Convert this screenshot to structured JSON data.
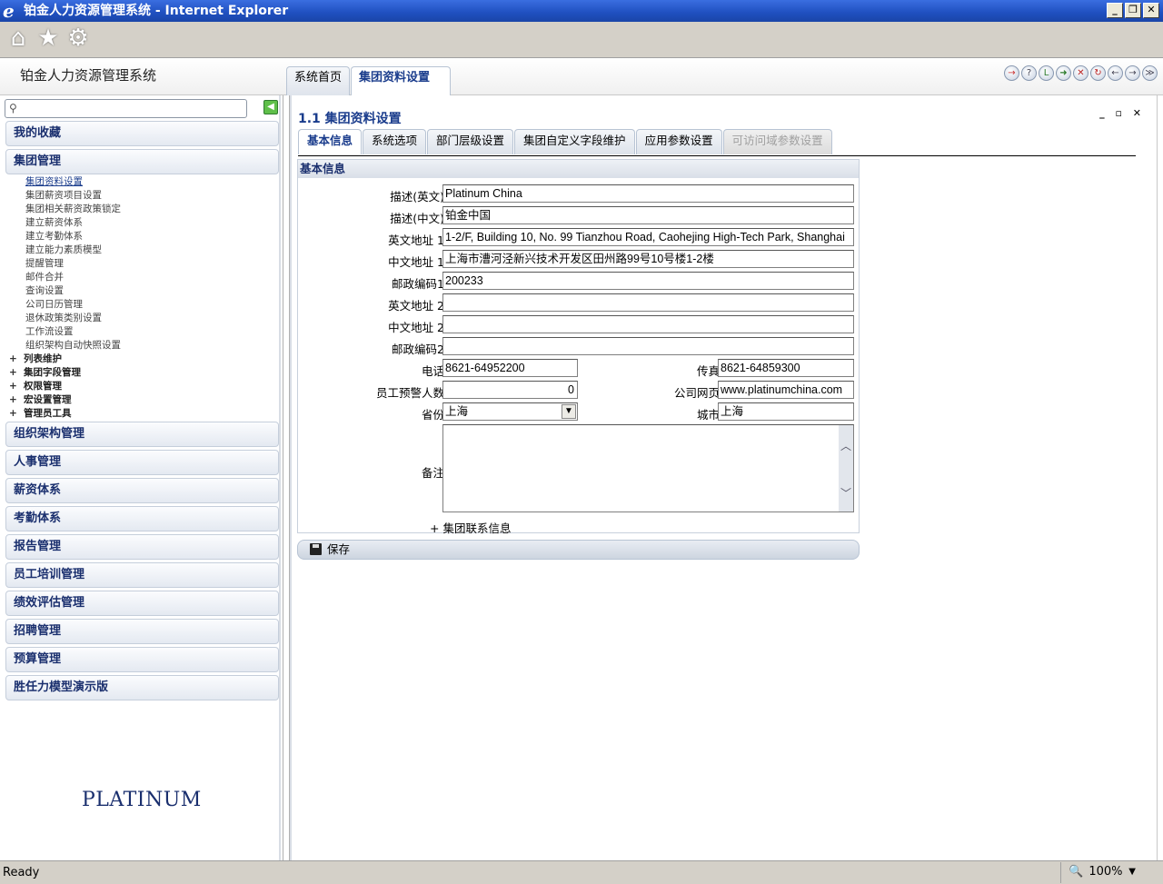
{
  "window": {
    "title": "铂金人力资源管理系统 - Internet Explorer",
    "controls": [
      "_",
      "❐",
      "✕"
    ]
  },
  "toolbar": {
    "icons": [
      "home-icon",
      "star-icon",
      "gear-icon"
    ]
  },
  "app": {
    "title": "铂金人力资源管理系统",
    "tabs": [
      {
        "label": "系统首页",
        "active": false
      },
      {
        "label": "集团资料设置",
        "active": true
      }
    ],
    "action_icons": [
      "logout-icon",
      "help-icon",
      "user-lock-icon",
      "user-go-icon",
      "close-icon",
      "refresh-icon",
      "back-icon",
      "forward-icon",
      "collapse-icon"
    ]
  },
  "sidebar": {
    "search_placeholder": "",
    "sections_top": [
      "我的收藏",
      "集团管理"
    ],
    "group_items": [
      {
        "label": "集团资料设置",
        "selected": true
      },
      {
        "label": "集团薪资项目设置",
        "selected": false
      },
      {
        "label": "集团相关薪资政策锁定",
        "selected": false
      },
      {
        "label": "建立薪资体系",
        "selected": false
      },
      {
        "label": "建立考勤体系",
        "selected": false
      },
      {
        "label": "建立能力素质模型",
        "selected": false
      },
      {
        "label": "提醒管理",
        "selected": false
      },
      {
        "label": "邮件合并",
        "selected": false
      },
      {
        "label": "查询设置",
        "selected": false
      },
      {
        "label": "公司日历管理",
        "selected": false
      },
      {
        "label": "退休政策类别设置",
        "selected": false
      },
      {
        "label": "工作流设置",
        "selected": false
      },
      {
        "label": "组织架构自动快照设置",
        "selected": false
      }
    ],
    "expandable_groups": [
      "列表维护",
      "集团字段管理",
      "权限管理",
      "宏设置管理",
      "管理员工具"
    ],
    "sections_bottom": [
      "组织架构管理",
      "人事管理",
      "薪资体系",
      "考勤体系",
      "报告管理",
      "员工培训管理",
      "绩效评估管理",
      "招聘管理",
      "预算管理",
      "胜任力模型演示版"
    ],
    "brand": "PLATINUM"
  },
  "main": {
    "page_title": "1.1 集团资料设置",
    "window_controls": "_ ▫ ✕",
    "tabs": [
      {
        "label": "基本信息",
        "state": "active"
      },
      {
        "label": "系统选项",
        "state": "normal"
      },
      {
        "label": "部门层级设置",
        "state": "normal"
      },
      {
        "label": "集团自定义字段维护",
        "state": "normal"
      },
      {
        "label": "应用参数设置",
        "state": "normal"
      },
      {
        "label": "可访问域参数设置",
        "state": "disabled"
      }
    ],
    "panel_title": "基本信息",
    "form": {
      "desc_en": {
        "label": "描述(英文)",
        "value": "Platinum China"
      },
      "desc_cn": {
        "label": "描述(中文)",
        "value": "铂金中国"
      },
      "addr_en1": {
        "label": "英文地址 1",
        "value": "1-2/F, Building 10, No. 99 Tianzhou Road, Caohejing High-Tech Park, Shanghai"
      },
      "addr_cn1": {
        "label": "中文地址 1",
        "value": "上海市漕河泾新兴技术开发区田州路99号10号楼1-2楼"
      },
      "zip1": {
        "label": "邮政编码1",
        "value": "200233"
      },
      "addr_en2": {
        "label": "英文地址 2",
        "value": ""
      },
      "addr_cn2": {
        "label": "中文地址 2",
        "value": ""
      },
      "zip2": {
        "label": "邮政编码2",
        "value": ""
      },
      "phone": {
        "label": "电话",
        "value": "8621-64952200"
      },
      "fax": {
        "label": "传真",
        "value": "8621-64859300"
      },
      "warn_count": {
        "label": "员工预警人数",
        "value": "0"
      },
      "website": {
        "label": "公司网页",
        "value": "www.platinumchina.com"
      },
      "province": {
        "label": "省份",
        "value": "上海"
      },
      "city": {
        "label": "城市",
        "value": "上海"
      },
      "remarks": {
        "label": "备注",
        "value": ""
      },
      "contact_link": "+ 集团联系信息"
    },
    "save_label": "保存"
  },
  "statusbar": {
    "text": "Ready",
    "zoom": "100%"
  }
}
